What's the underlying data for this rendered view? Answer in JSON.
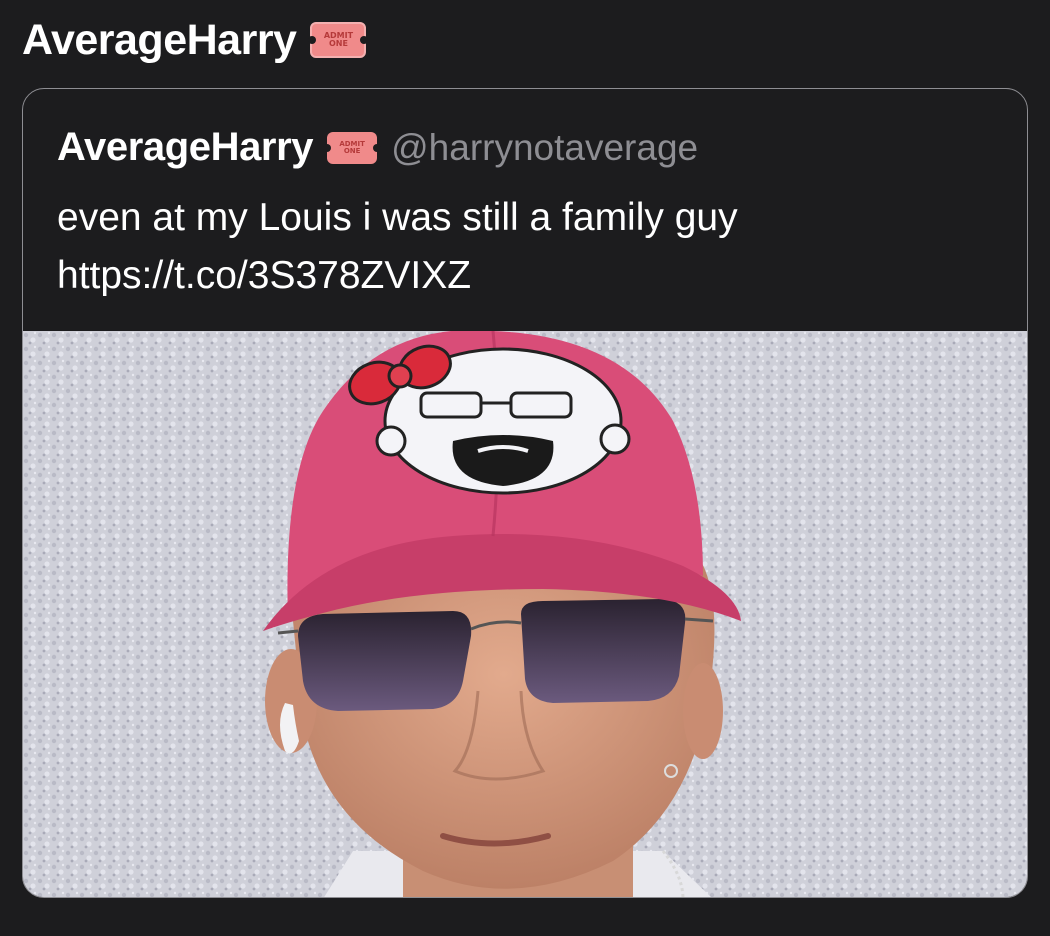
{
  "retweeter": {
    "display_name": "AverageHarry",
    "badge_icon": "admit-one-ticket-icon",
    "badge_text": [
      "ADMIT",
      "ONE"
    ]
  },
  "quoted_tweet": {
    "display_name": "AverageHarry",
    "badge_icon": "admit-one-ticket-icon",
    "badge_text": [
      "ADMIT",
      "ONE"
    ],
    "handle": "@harrynotaverage",
    "text_line1": "even at my Louis i was still a family guy",
    "text_line2": "https://t.co/3S378ZVIXZ",
    "media": {
      "type": "photo"
    }
  },
  "colors": {
    "background": "#1c1c1e",
    "text_primary": "#ffffff",
    "text_secondary": "#8e8e93",
    "card_border": "#8e8e93",
    "ticket": "#f08a8a",
    "cap": "#d94d78",
    "wall": "#cfd0d8"
  }
}
